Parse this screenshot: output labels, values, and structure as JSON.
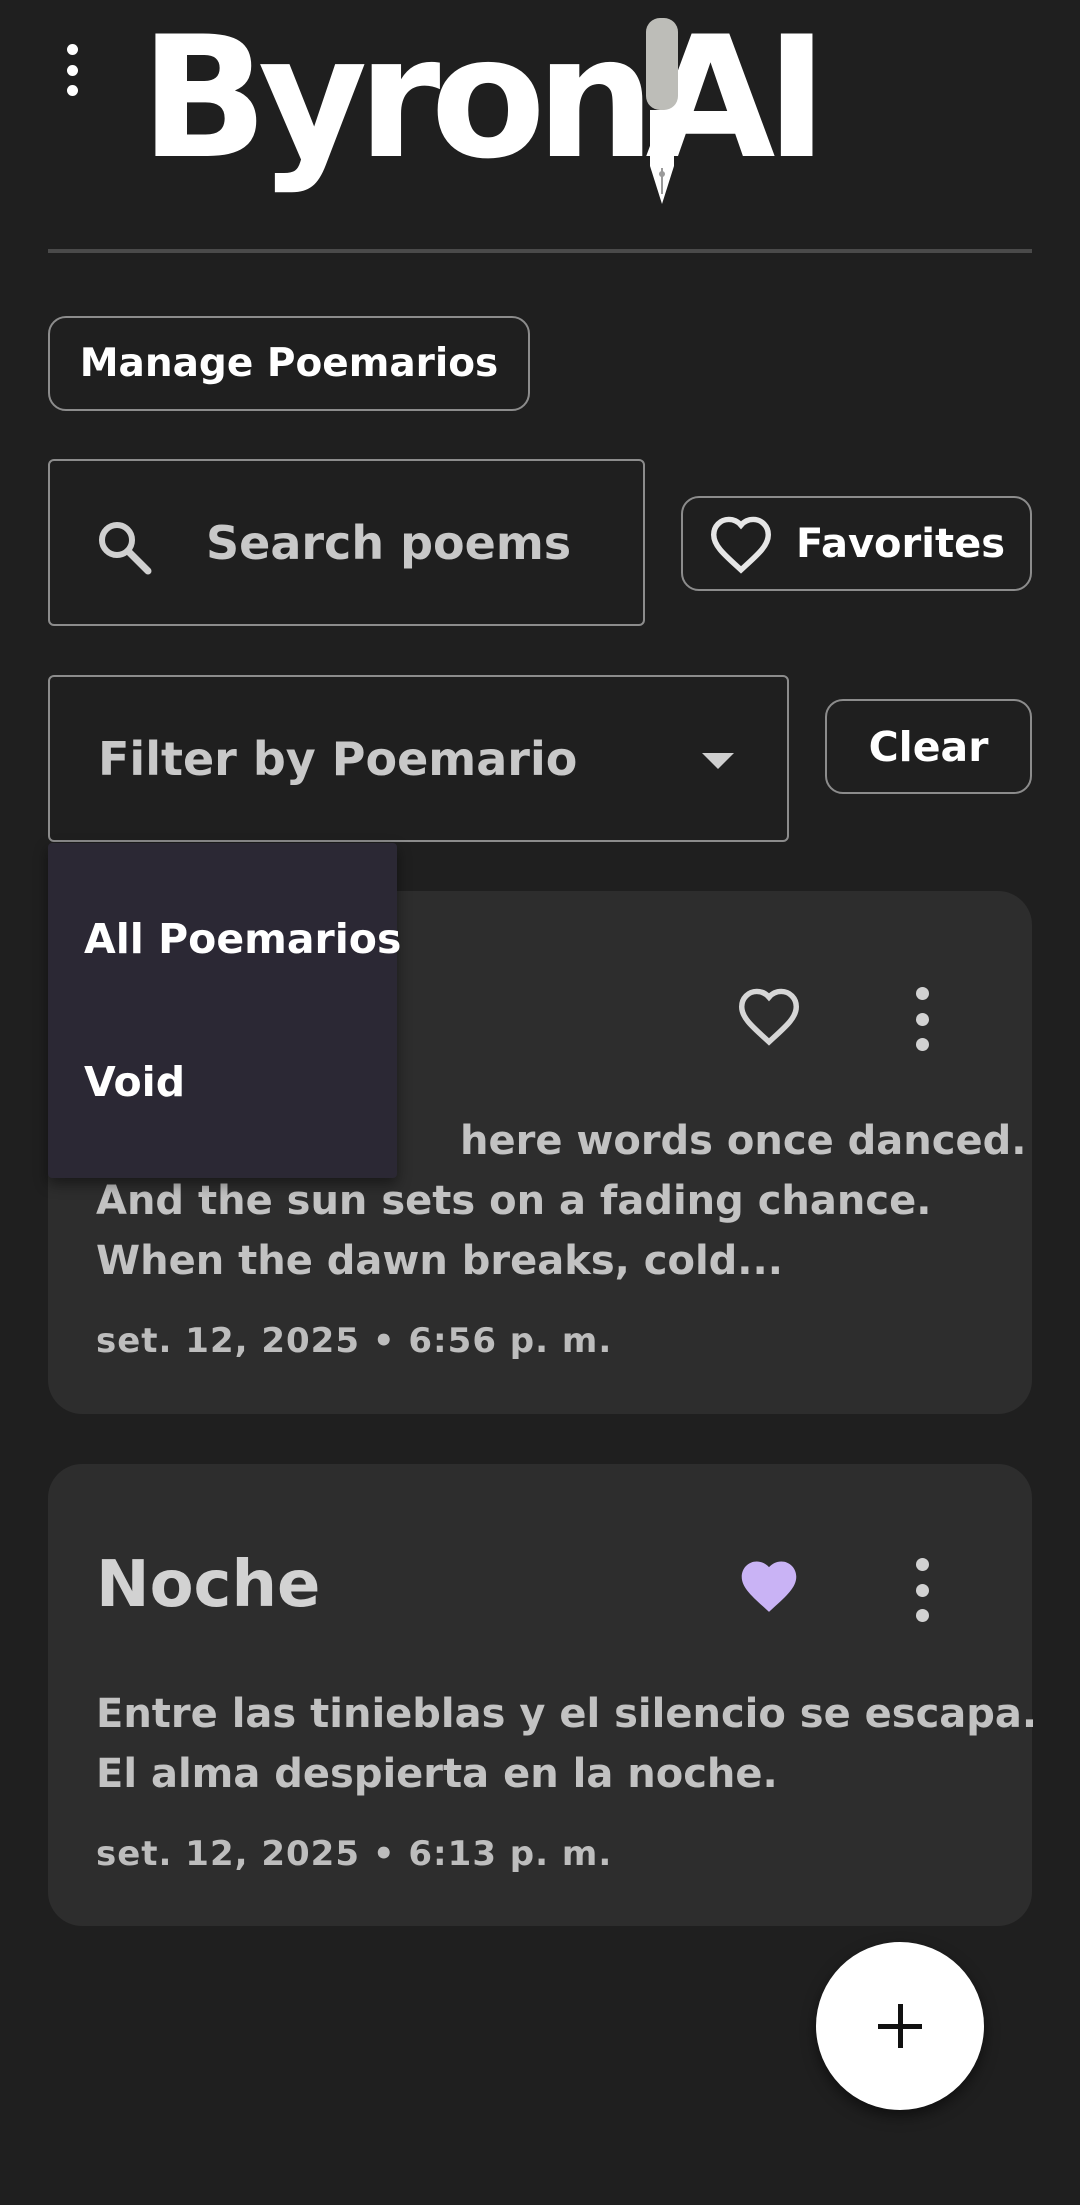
{
  "app": {
    "logo_text": "ByronAI"
  },
  "toolbar": {
    "manage_label": "Manage Poemarios",
    "favorites_label": "Favorites",
    "clear_label": "Clear"
  },
  "search": {
    "placeholder": "Search poems"
  },
  "filter": {
    "label": "Filter by Poemario",
    "options": [
      "All Poemarios",
      "Void"
    ]
  },
  "poems": [
    {
      "title": "",
      "lines": [
        "here words once danced.",
        "And the sun sets on a fading chance.",
        "When the dawn breaks, cold..."
      ],
      "date": "set. 12, 2025 • 6:56 p. m.",
      "favorite": false
    },
    {
      "title": "Noche",
      "lines": [
        "Entre las tinieblas y el silencio se escapa.",
        "El alma despierta en la noche."
      ],
      "date": "set. 12, 2025 • 6:13 p. m.",
      "favorite": true
    }
  ],
  "colors": {
    "background": "#1f1f1f",
    "card": "#2d2d2d",
    "favorite_accent": "#c9b3f5",
    "dropdown": "#2b2834"
  },
  "icons": {
    "menu": "vertical-dots-icon",
    "search": "search-icon",
    "favorites": "heart-outline-icon",
    "filter": "caret-down-icon",
    "favorite_on": "heart-filled-icon",
    "favorite_off": "heart-outline-icon",
    "more": "more-vertical-icon",
    "add": "plus-icon"
  }
}
